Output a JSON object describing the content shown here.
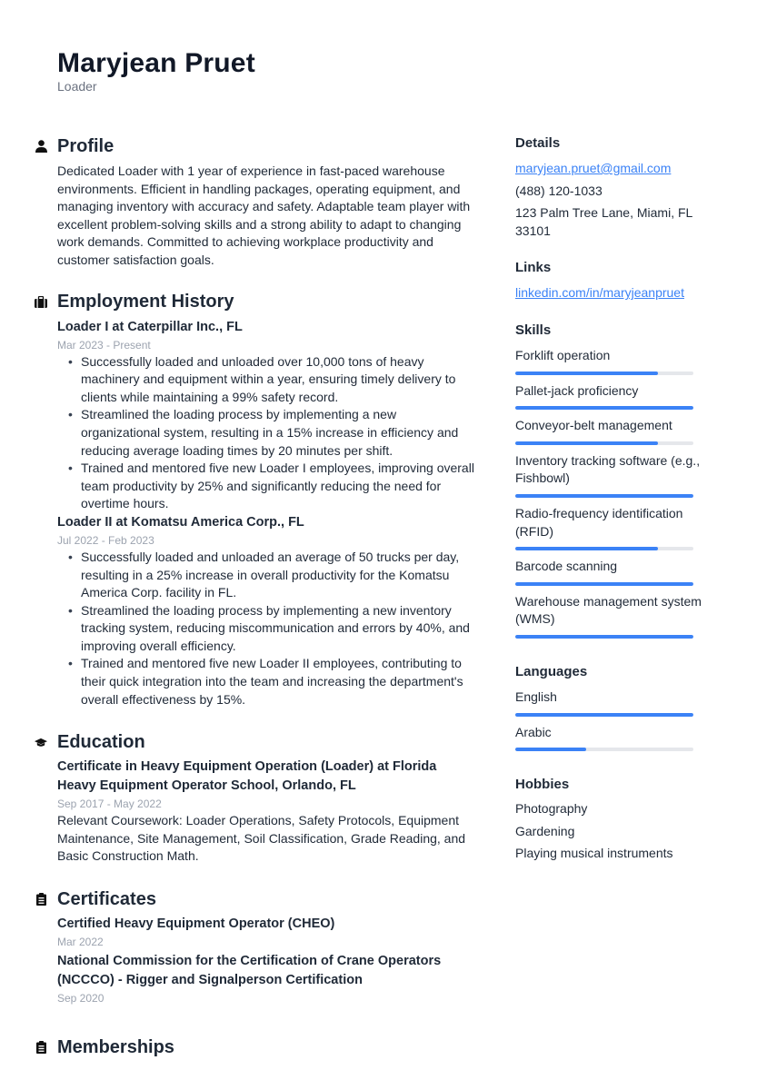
{
  "header": {
    "name": "Maryjean Pruet",
    "title": "Loader"
  },
  "profile": {
    "heading": "Profile",
    "icon": "person-icon",
    "text": "Dedicated Loader with 1 year of experience in fast-paced warehouse environments. Efficient in handling packages, operating equipment, and managing inventory with accuracy and safety. Adaptable team player with excellent problem-solving skills and a strong ability to adapt to changing work demands. Committed to achieving workplace productivity and customer satisfaction goals."
  },
  "employment": {
    "heading": "Employment History",
    "icon": "briefcase-icon",
    "jobs": [
      {
        "title": "Loader I at Caterpillar Inc., FL",
        "dates": "Mar 2023 - Present",
        "bullets": [
          "Successfully loaded and unloaded over 10,000 tons of heavy machinery and equipment within a year, ensuring timely delivery to clients while maintaining a 99% safety record.",
          "Streamlined the loading process by implementing a new organizational system, resulting in a 15% increase in efficiency and reducing average loading times by 20 minutes per shift.",
          "Trained and mentored five new Loader I employees, improving overall team productivity by 25% and significantly reducing the need for overtime hours."
        ]
      },
      {
        "title": "Loader II at Komatsu America Corp., FL",
        "dates": "Jul 2022 - Feb 2023",
        "bullets": [
          "Successfully loaded and unloaded an average of 50 trucks per day, resulting in a 25% increase in overall productivity for the Komatsu America Corp. facility in FL.",
          "Streamlined the loading process by implementing a new inventory tracking system, reducing miscommunication and errors by 40%, and improving overall efficiency.",
          "Trained and mentored five new Loader II employees, contributing to their quick integration into the team and increasing the department's overall effectiveness by 15%."
        ]
      }
    ]
  },
  "education": {
    "heading": "Education",
    "icon": "graduation-cap-icon",
    "items": [
      {
        "title": "Certificate in Heavy Equipment Operation (Loader) at Florida Heavy Equipment Operator School, Orlando, FL",
        "dates": "Sep 2017 - May 2022",
        "description": "Relevant Coursework: Loader Operations, Safety Protocols, Equipment Maintenance, Site Management, Soil Classification, Grade Reading, and Basic Construction Math."
      }
    ]
  },
  "certificates": {
    "heading": "Certificates",
    "icon": "clipboard-icon",
    "items": [
      {
        "title": "Certified Heavy Equipment Operator (CHEO)",
        "date": "Mar 2022"
      },
      {
        "title": "National Commission for the Certification of Crane Operators (NCCCO) - Rigger and Signalperson Certification",
        "date": "Sep 2020"
      }
    ]
  },
  "memberships": {
    "heading": "Memberships",
    "icon": "clipboard-icon"
  },
  "details": {
    "heading": "Details",
    "email": "maryjean.pruet@gmail.com",
    "phone": "(488) 120-1033",
    "address": "123 Palm Tree Lane, Miami, FL 33101"
  },
  "links": {
    "heading": "Links",
    "items": [
      "linkedin.com/in/maryjeanpruet"
    ]
  },
  "skills": {
    "heading": "Skills",
    "items": [
      {
        "name": "Forklift operation",
        "level": 0.8
      },
      {
        "name": "Pallet-jack proficiency",
        "level": 1.0
      },
      {
        "name": "Conveyor-belt management",
        "level": 0.8
      },
      {
        "name": "Inventory tracking software (e.g., Fishbowl)",
        "level": 1.0
      },
      {
        "name": "Radio-frequency identification (RFID)",
        "level": 0.8
      },
      {
        "name": "Barcode scanning",
        "level": 1.0
      },
      {
        "name": "Warehouse management system (WMS)",
        "level": 1.0
      }
    ]
  },
  "languages": {
    "heading": "Languages",
    "items": [
      {
        "name": "English",
        "level": 1.0
      },
      {
        "name": "Arabic",
        "level": 0.4
      }
    ]
  },
  "hobbies": {
    "heading": "Hobbies",
    "items": [
      "Photography",
      "Gardening",
      "Playing musical instruments"
    ]
  },
  "colors": {
    "accent": "#3b82f6",
    "bar_track": "#e5e7eb",
    "text": "#1f2937",
    "muted": "#9ca3af"
  }
}
